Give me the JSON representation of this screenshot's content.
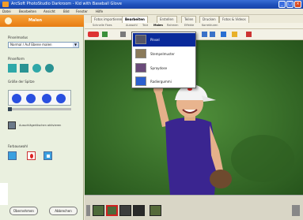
{
  "window": {
    "title": "ArcSoft PhotoStudio Darkroom - Kid with Baseball Glove",
    "buttons": [
      "_",
      "□",
      "×"
    ]
  },
  "menubar": [
    "Datei",
    "Bearbeiten",
    "Ansicht",
    "Bild",
    "Fenster",
    "Hilfe"
  ],
  "left_panel": {
    "header": "Malen",
    "section_brush_mode": "Pinselmodus",
    "brush_mode_value": "Normal / Auf Ebene malen",
    "section_shape": "Pinselform",
    "section_brush_size": "Größe der Spitze",
    "checkbox_label": "Ausschlägerlöschen aktivieren",
    "section_color": "Farbauswahl",
    "button_ok": "Übernehmen",
    "button_cancel": "Abbrechen",
    "accent": "#e77d12"
  },
  "tabs": [
    "Fotos importieren",
    "Bearbeiten",
    "Erstellen",
    "Teilen",
    "Drucken",
    "Fotos & Videos"
  ],
  "active_tab": "Bearbeiten",
  "subtabs": [
    "Schnelle Fixes",
    "Auswahl",
    "Text",
    "Malen",
    "Rahmen",
    "Effekte",
    "Korrekturen"
  ],
  "dropdown": {
    "items": [
      {
        "label": "Pinsel",
        "icon": "brush-thumb-icon"
      },
      {
        "label": "Stempelmuster",
        "icon": "stamp-thumb-icon"
      },
      {
        "label": "Spraydose",
        "icon": "spray-thumb-icon"
      },
      {
        "label": "Radiergummi",
        "icon": "eraser-thumb-icon"
      }
    ],
    "selected": "Pinsel"
  },
  "filmstrip": {
    "thumb_count": 6,
    "selected_index": 1
  }
}
